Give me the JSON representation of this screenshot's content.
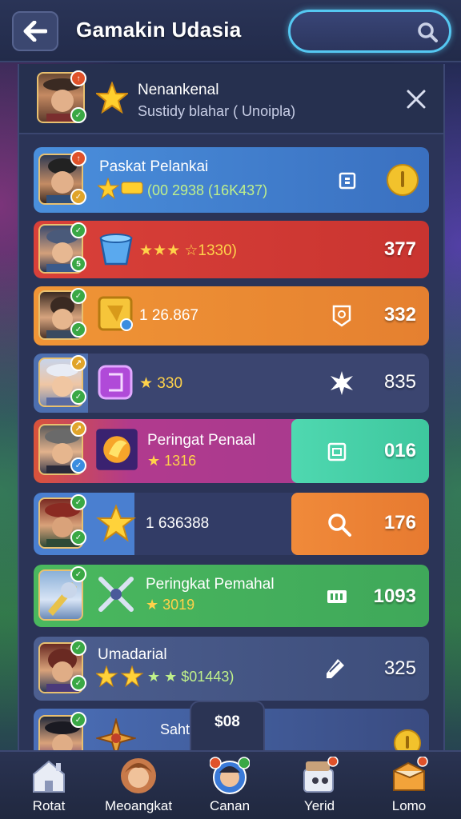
{
  "header": {
    "title": "Gamakin Udasia",
    "search_placeholder": ""
  },
  "notification": {
    "title": "Nenankenal",
    "subtitle": "Sustidy blahar ( Unoipla)"
  },
  "rows": [
    {
      "title": "Paskat Pelankai",
      "stat": "(00 2938 (16K437)",
      "value": "",
      "color": "#3f7fcf"
    },
    {
      "title": "",
      "stat": "★★★ ☆1330)",
      "value": "377",
      "color": "#d53c36"
    },
    {
      "title": "",
      "stat": "1 26.867",
      "value": "332",
      "color": "#ec8a33"
    },
    {
      "title": "",
      "stat": "★ 330",
      "value": "835",
      "color": "#3b4570"
    },
    {
      "title": "Peringat Penaal",
      "stat": "★ 1316",
      "value": "016",
      "color": "#b23b8f"
    },
    {
      "title": "",
      "stat": "1 636388",
      "value": "176",
      "color": "#3b4570"
    },
    {
      "title": "Peringkat Pemahal",
      "stat": "★ 3019",
      "value": "1093",
      "color": "#3fa85a"
    },
    {
      "title": "Umadarial",
      "stat": "★ ★ $01443)",
      "value": "325",
      "color": "#3d4d7a"
    },
    {
      "title": "Sahtak",
      "stat": "",
      "value": "",
      "color": "#3a4b80"
    }
  ],
  "center_tab": {
    "label": "$08"
  },
  "nav": [
    {
      "label": "Rotat",
      "icon": "house-icon"
    },
    {
      "label": "Meoangkat",
      "icon": "player-avatar-icon"
    },
    {
      "label": "Canan",
      "icon": "player-profile-icon"
    },
    {
      "label": "Yerid",
      "icon": "gift-box-icon"
    },
    {
      "label": "Lomo",
      "icon": "treasure-chest-icon"
    }
  ],
  "colors": {
    "accent": "#55c8f2",
    "panel": "#2b3457",
    "bar": "#222b4a"
  }
}
